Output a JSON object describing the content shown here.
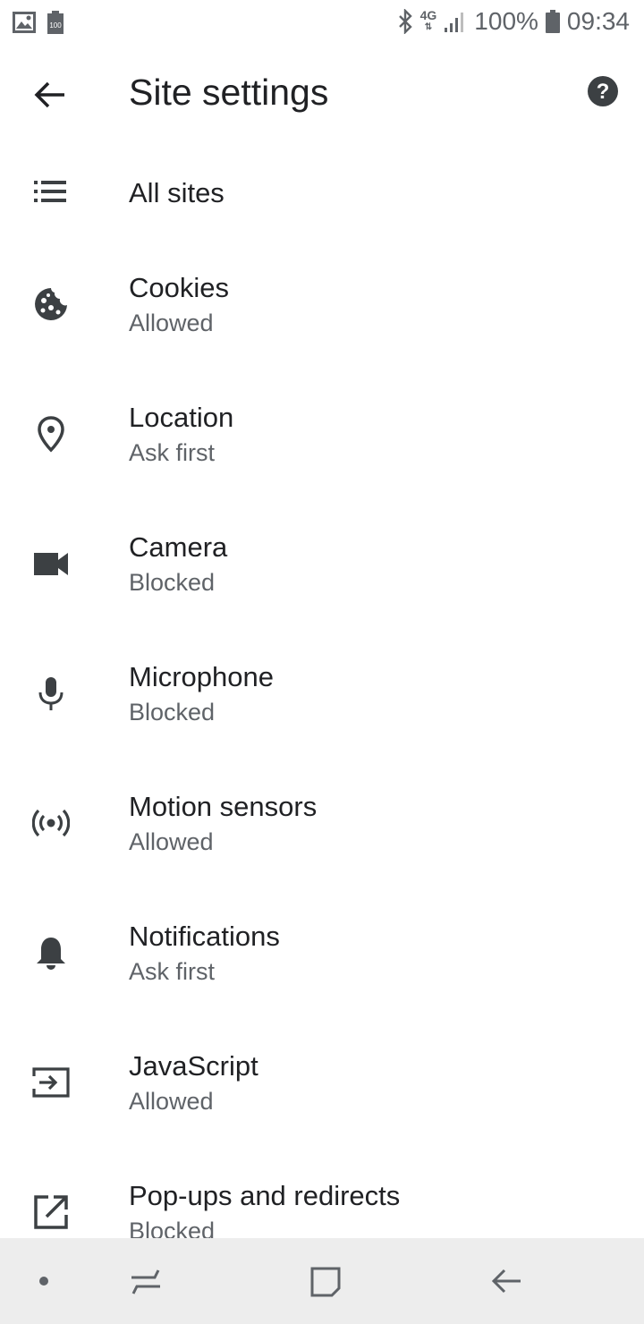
{
  "status_bar": {
    "battery_percent": "100%",
    "time": "09:34",
    "network": "4G",
    "icons": [
      "image-icon",
      "battery-saver-icon",
      "bluetooth-icon",
      "network-4g-icon",
      "signal-icon",
      "battery-icon"
    ]
  },
  "app_bar": {
    "title": "Site settings",
    "icons": [
      "back-arrow-icon",
      "help-icon"
    ]
  },
  "items": [
    {
      "label": "All sites",
      "sub": "",
      "icon": "list-icon"
    },
    {
      "label": "Cookies",
      "sub": "Allowed",
      "icon": "cookie-icon"
    },
    {
      "label": "Location",
      "sub": "Ask first",
      "icon": "location-pin-icon"
    },
    {
      "label": "Camera",
      "sub": "Blocked",
      "icon": "videocam-icon"
    },
    {
      "label": "Microphone",
      "sub": "Blocked",
      "icon": "mic-icon"
    },
    {
      "label": "Motion sensors",
      "sub": "Allowed",
      "icon": "sensors-icon"
    },
    {
      "label": "Notifications",
      "sub": "Ask first",
      "icon": "bell-icon"
    },
    {
      "label": "JavaScript",
      "sub": "Allowed",
      "icon": "javascript-input-icon"
    },
    {
      "label": "Pop-ups and redirects",
      "sub": "Blocked",
      "icon": "open-in-new-icon"
    }
  ],
  "nav_bar": {
    "icons": [
      "dot-icon",
      "recents-icon",
      "home-icon",
      "back-icon"
    ]
  },
  "colors": {
    "text_primary": "#202124",
    "text_secondary": "#5f6368",
    "icon": "#3c4043",
    "nav_bg": "#ededed"
  }
}
